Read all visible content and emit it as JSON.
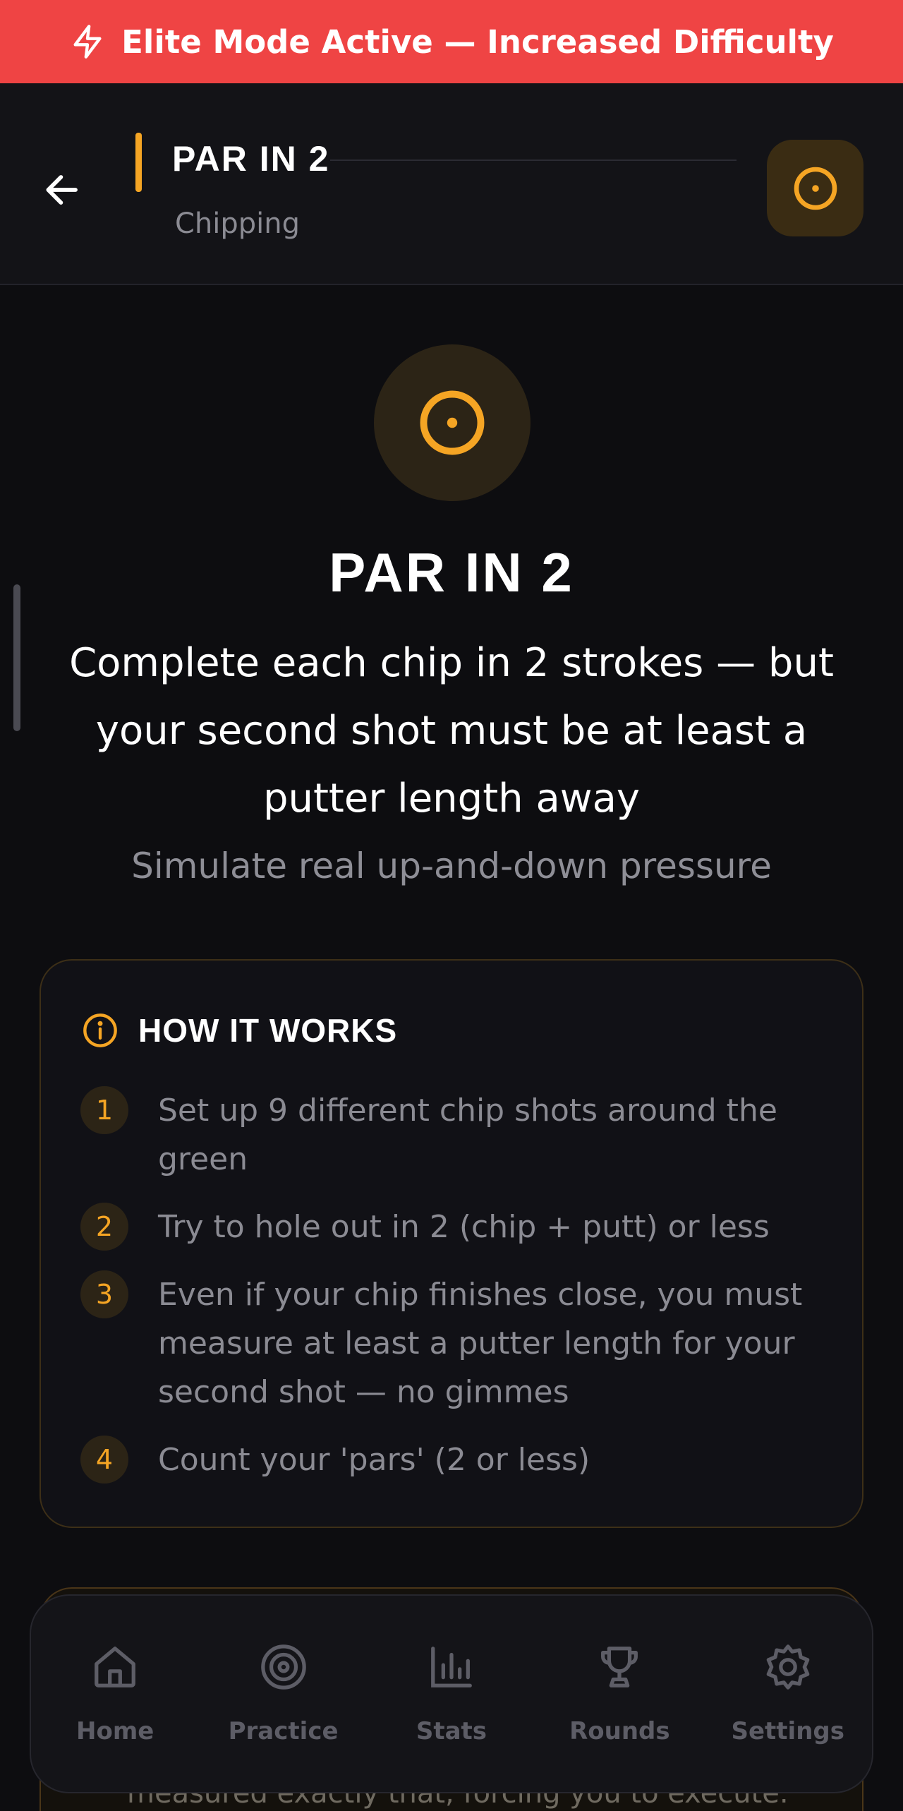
{
  "banner": {
    "text": "Elite Mode Active — Increased Difficulty",
    "color": "#ef4444"
  },
  "header": {
    "title": "PAR IN 2",
    "subtitle": "Chipping"
  },
  "hero": {
    "title": "PAR IN 2",
    "description": "Complete each chip in 2 strokes — but your second shot must be at least a putter length away",
    "subdescription": "Simulate real up-and-down pressure"
  },
  "how_it_works": {
    "title": "HOW IT WORKS",
    "steps": [
      {
        "num": "1",
        "text": "Set up 9 different chip shots around the green"
      },
      {
        "num": "2",
        "text": "Try to hole out in 2 (chip + putt) or less"
      },
      {
        "num": "3",
        "text": "Even if your chip finishes close, you must measure at least a putter length for your second shot — no gimmes"
      },
      {
        "num": "4",
        "text": "Count your 'pars' (2 or less)"
      }
    ]
  },
  "partial_card_text": "measured exactly that, forcing you to execute.",
  "nav": {
    "items": [
      {
        "label": "Home",
        "icon": "home-icon"
      },
      {
        "label": "Practice",
        "icon": "target-icon"
      },
      {
        "label": "Stats",
        "icon": "bar-chart-icon"
      },
      {
        "label": "Rounds",
        "icon": "trophy-icon"
      },
      {
        "label": "Settings",
        "icon": "gear-icon"
      }
    ]
  },
  "colors": {
    "accent": "#f5a524",
    "background": "#0d0d10",
    "banner": "#ef4444"
  }
}
